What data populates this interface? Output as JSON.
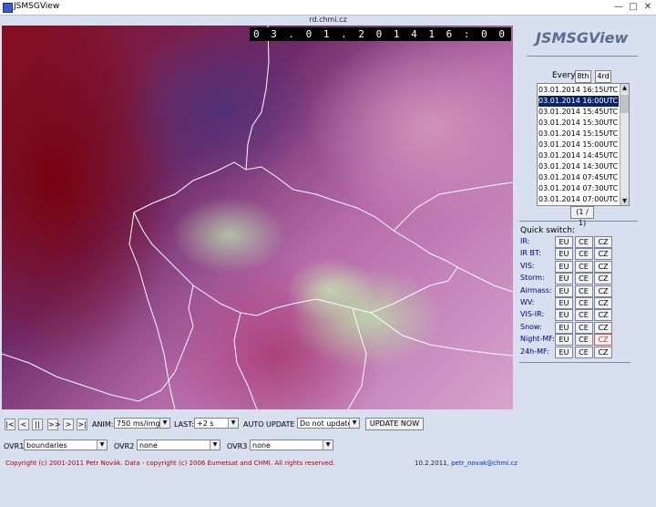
{
  "window": {
    "title": "JSMSGView",
    "url": "rd.chmi.cz"
  },
  "map": {
    "timestamp": "0 3 . 0 1 . 2 0 1 4   1 6 : 0 0"
  },
  "sidebar": {
    "logo": "JSMSGView",
    "every_label": "Every",
    "every_buttons": [
      "8th",
      "4rd"
    ],
    "times": [
      "03.01.2014 16:15UTC",
      "03.01.2014 16:00UTC",
      "03.01.2014 15:45UTC",
      "03.01.2014 15:30UTC",
      "03.01.2014 15:15UTC",
      "03.01.2014 15:00UTC",
      "03.01.2014 14:45UTC",
      "03.01.2014 14:30UTC",
      "03.01.2014 07:45UTC",
      "03.01.2014 07:30UTC",
      "03.01.2014 07:15UTC",
      "03.01.2014 07:00UTC"
    ],
    "selected_index": 1,
    "pager": "(1 / 1)"
  },
  "quick_switch": {
    "title": "Quick switch:",
    "rows": [
      {
        "label": "IR:",
        "buttons": [
          "EU",
          "CE",
          "CZ"
        ]
      },
      {
        "label": "IR BT:",
        "buttons": [
          "EU",
          "CE",
          "CZ"
        ]
      },
      {
        "label": "VIS:",
        "buttons": [
          "EU",
          "CE",
          "CZ"
        ]
      },
      {
        "label": "Storm:",
        "buttons": [
          "EU",
          "CE",
          "CZ"
        ]
      },
      {
        "label": "Airmass:",
        "buttons": [
          "EU",
          "CE",
          "CZ"
        ]
      },
      {
        "label": "WV:",
        "buttons": [
          "EU",
          "CE",
          "CZ"
        ]
      },
      {
        "label": "VIS-IR:",
        "buttons": [
          "EU",
          "CE",
          "CZ"
        ]
      },
      {
        "label": "Snow:",
        "buttons": [
          "EU",
          "CE",
          "CZ"
        ]
      },
      {
        "label": "Night-MF:",
        "buttons": [
          "EU",
          "CE",
          "CZ"
        ]
      },
      {
        "label": "24h-MF:",
        "buttons": [
          "EU",
          "CE",
          "CZ"
        ]
      }
    ]
  },
  "controls": {
    "nav_buttons": [
      "|<",
      "<",
      "||",
      ">>",
      ">",
      ">|"
    ],
    "anim_label": "ANIM:",
    "anim_value": "750 ms/img",
    "last_label": "LAST:",
    "last_value": "+2 s",
    "auto_update_label": "AUTO UPDATE",
    "auto_update_value": "Do not update",
    "update_now": "UPDATE NOW",
    "ovr1_label": "OVR1",
    "ovr1_value": "boundaries",
    "ovr2_label": "OVR2",
    "ovr2_value": "none",
    "ovr3_label": "OVR3",
    "ovr3_value": "none"
  },
  "footer": {
    "copyright": "Copyright (c) 2001-2011 Petr Novák. Data - copyright (c) 2006 Eumetsat and CHMI. All rights reserved.",
    "date": "10.2.2011,",
    "email": "petr_novak@chmi.cz"
  }
}
